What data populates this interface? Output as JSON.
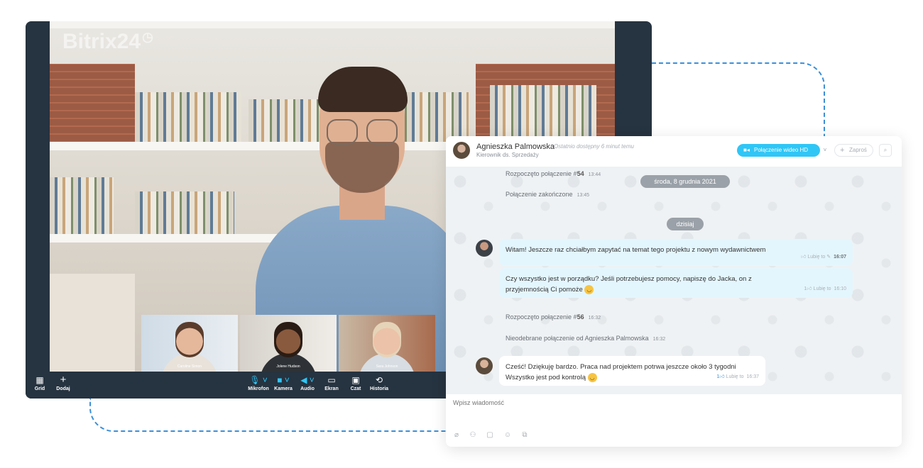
{
  "video": {
    "brand_logo": "Bitrix24",
    "brand_clock": "◷",
    "participants": [
      {
        "name": "Caroline Simon"
      },
      {
        "name": "Jolene Hudson"
      },
      {
        "name": "Sara Johnson"
      }
    ],
    "toolbar": {
      "grid_label": "Grid",
      "add_label": "Dodaj",
      "mic_label": "Mikrofon",
      "camera_label": "Kamera",
      "audio_label": "Audio",
      "screen_label": "Ekran",
      "chat_label": "Czat",
      "history_label": "Historia"
    }
  },
  "chat": {
    "contact_name": "Agnieszka Palmowska",
    "contact_status": "Ostatnio dostępny 6 minut temu",
    "contact_role": "Kierownik ds. Sprzedaży",
    "video_call_label": "Połączenie wideo HD",
    "invite_label": "Zaproś",
    "messages": {
      "sys1_text": "Rozpoczęto połączenie #",
      "sys1_num": "54",
      "sys1_time": "13:44",
      "date_divider_1": "środa, 8 grudnia 2021",
      "sys2_text": "Połączenie zakończone",
      "sys2_time": "13:45",
      "date_divider_2": "dzisiaj",
      "m1_text": "Witam! Jeszcze raz chciałbym zapytać na temat tego projektu z nowym wydawnictwem",
      "m1_like": "Lubię to",
      "m1_time": "16:07",
      "m2_text": "Czy wszystko jest w porządku? Jeśli potrzebujesz pomocy, napiszę do Jacka, on z przyjemnością Ci pomoże",
      "m2_like_count": "1",
      "m2_like": "Lubię to",
      "m2_time": "16:10",
      "sys3_text": "Rozpoczęto połączenie #",
      "sys3_num": "56",
      "sys3_time": "16:32",
      "sys4_text": "Nieodebrane połączenie od Agnieszka Palmowska",
      "sys4_time": "16:32",
      "m3_line1": "Cześć! Dziękuję bardzo. Praca nad projektem potrwa jeszcze około 3 tygodni",
      "m3_line2": "Wszystko jest pod kontrolą",
      "m3_like_count": "1",
      "m3_like": "Lubię to",
      "m3_time": "16:37"
    },
    "input_placeholder": "Wpisz wiadomość"
  },
  "colors": {
    "accent": "#2fc6f6",
    "dark_panel": "#263340",
    "connector": "#3b8fd8"
  }
}
